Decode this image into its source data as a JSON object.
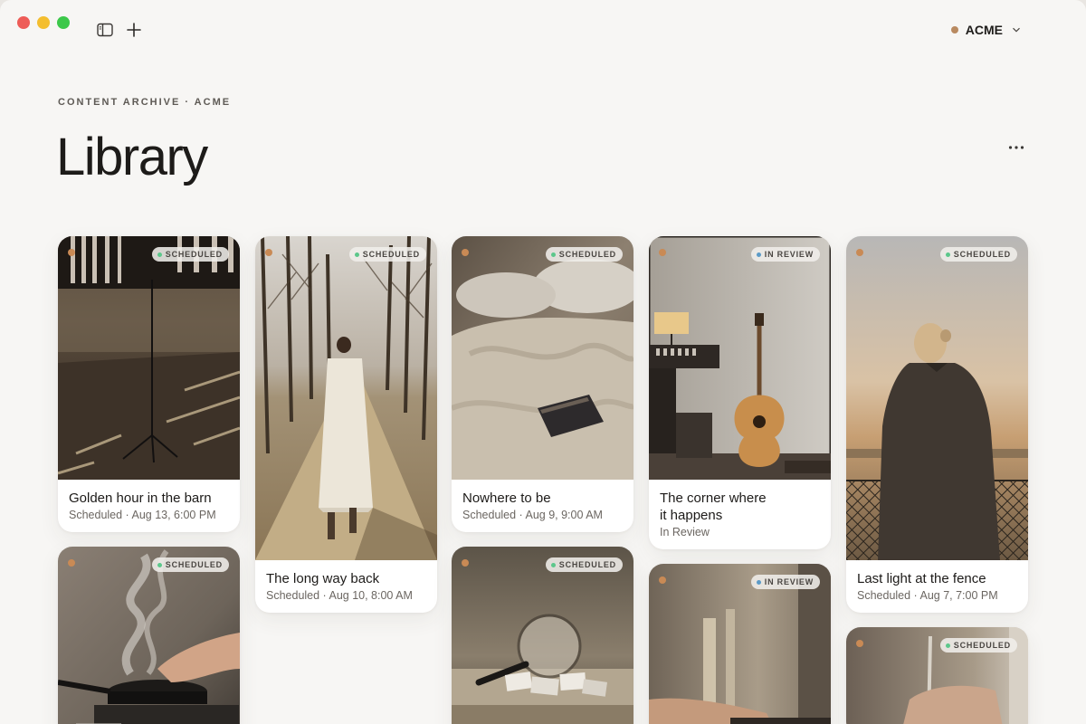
{
  "header": {
    "account_name": "ACME",
    "breadcrumb": "CONTENT ARCHIVE · ACME",
    "title": "Library"
  },
  "colors": {
    "accent": "#c98a55",
    "scheduled": "#5cc78b",
    "in_review": "#5c9bc7"
  },
  "cards": [
    {
      "title": "Golden hour in the barn",
      "status": "SCHEDULED",
      "subtitle": "Scheduled · Aug 13, 6:00 PM",
      "image": "barn-microphone"
    },
    {
      "title": "",
      "status": "SCHEDULED",
      "subtitle": "",
      "image": "steaming-pan"
    },
    {
      "title": "The long way back",
      "status": "SCHEDULED",
      "subtitle": "Scheduled · Aug 10, 8:00 AM",
      "image": "tree-lined-path"
    },
    {
      "title": "Nowhere to be",
      "status": "SCHEDULED",
      "subtitle": "Scheduled · Aug 9, 9:00 AM",
      "image": "unmade-bed"
    },
    {
      "title": "",
      "status": "SCHEDULED",
      "subtitle": "",
      "image": "magnifying-glass"
    },
    {
      "title": "The corner where it happens",
      "title_line1": "The corner where",
      "title_line2": "it happens",
      "status": "IN REVIEW",
      "subtitle": "In Review",
      "image": "studio-guitar"
    },
    {
      "title": "",
      "status": "IN REVIEW",
      "subtitle": "",
      "image": "hands-instrument"
    },
    {
      "title": "Last light at the fence",
      "status": "SCHEDULED",
      "subtitle": "Scheduled · Aug 7, 7:00 PM",
      "image": "fence-sunset"
    },
    {
      "title": "",
      "status": "SCHEDULED",
      "subtitle": "",
      "image": "writing-hand"
    }
  ]
}
